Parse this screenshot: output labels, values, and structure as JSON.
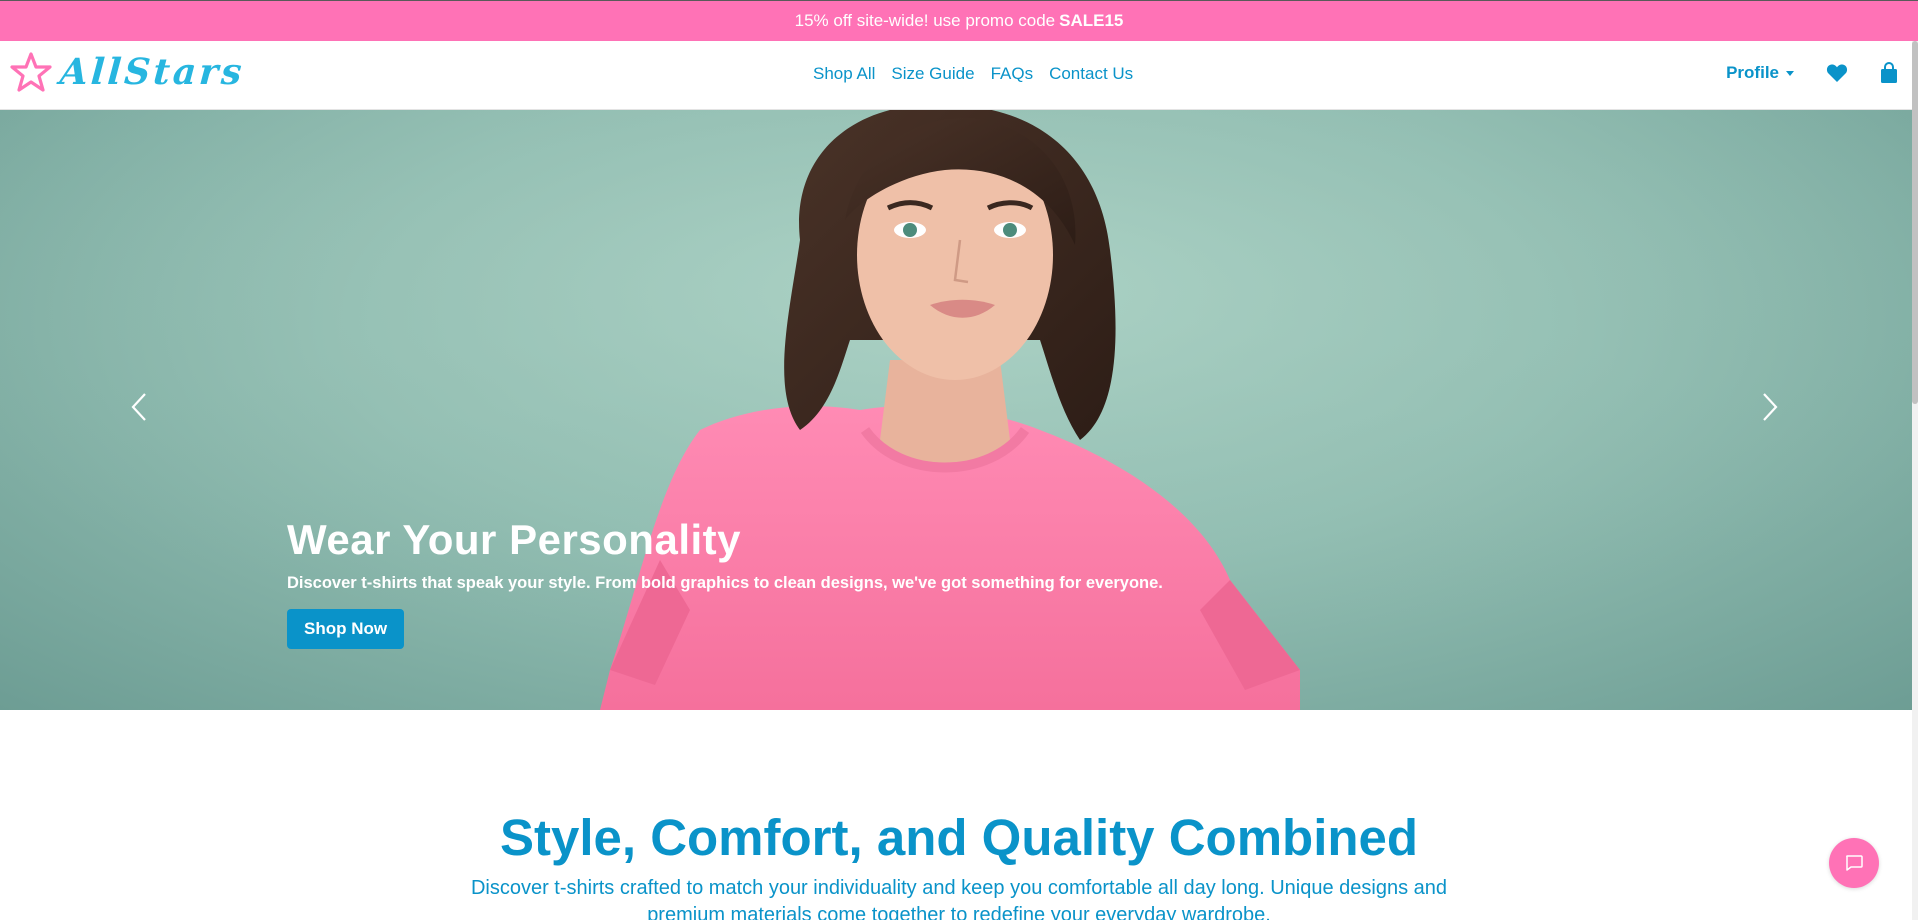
{
  "promo": {
    "text": "15% off site-wide! use promo code",
    "code": "SALE15"
  },
  "brand": {
    "name": "AllStars",
    "star_color": "#ff72b6",
    "text_color": "#27b6e0"
  },
  "nav": {
    "links": [
      "Shop All",
      "Size Guide",
      "FAQs",
      "Contact Us"
    ],
    "profile_label": "Profile",
    "icons": [
      "heart-icon",
      "shopping-bag-icon"
    ]
  },
  "hero": {
    "title": "Wear Your Personality",
    "subtitle": "Discover t-shirts that speak your style. From bold graphics to clean designs, we've got something for everyone.",
    "button": "Shop Now"
  },
  "section": {
    "title": "Style, Comfort, and Quality Combined",
    "subtitle": "Discover t-shirts crafted to match your individuality and keep you comfortable all day long. Unique designs and premium materials come together to redefine your everyday wardrobe."
  },
  "colors": {
    "accent": "#0a93c9",
    "brand_pink": "#ff72b6",
    "hero_bg": "#9cc6b9"
  }
}
